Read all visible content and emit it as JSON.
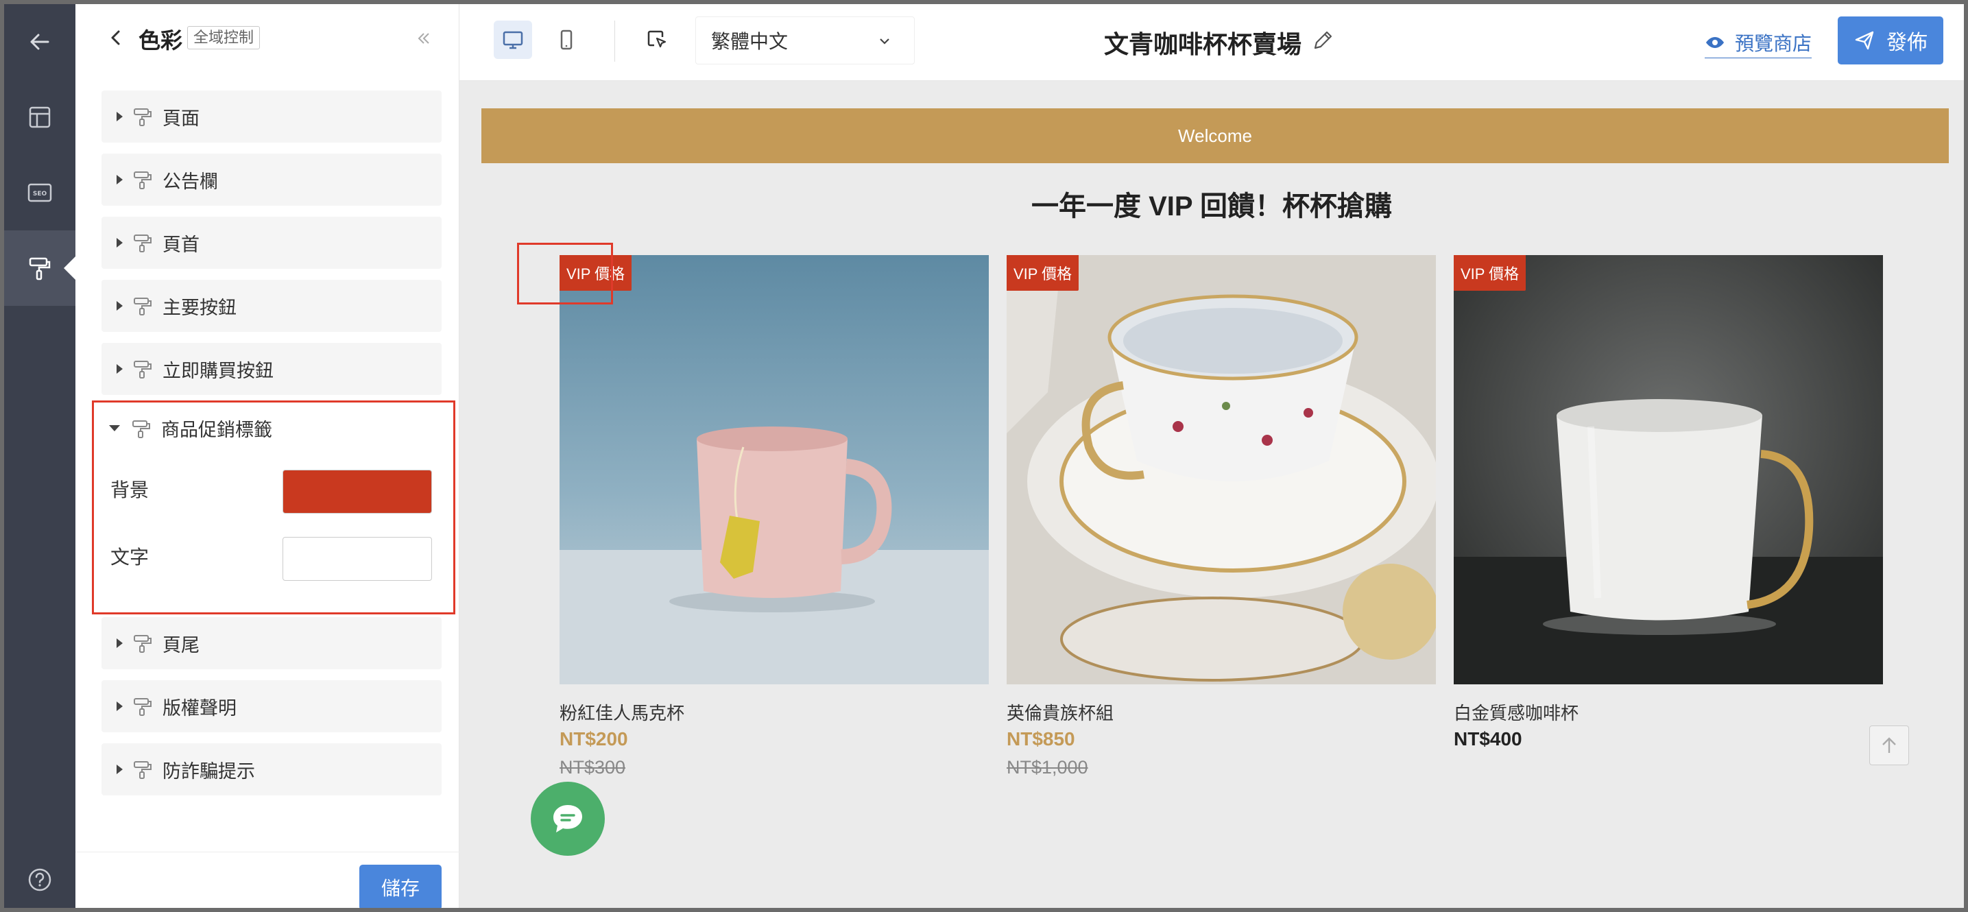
{
  "panel": {
    "title": "色彩",
    "scope_tag": "全域控制",
    "sections_top": [
      {
        "label": "頁面"
      },
      {
        "label": "公告欄"
      },
      {
        "label": "頁首"
      },
      {
        "label": "主要按鈕"
      },
      {
        "label": "立即購買按鈕"
      }
    ],
    "promo_section": {
      "label": "商品促銷標籤",
      "background_label": "背景",
      "background_color": "#c9391f",
      "text_label": "文字",
      "text_color": "#ffffff"
    },
    "sections_bottom": [
      {
        "label": "頁尾"
      },
      {
        "label": "版權聲明"
      },
      {
        "label": "防詐騙提示"
      }
    ],
    "save_label": "儲存"
  },
  "toolbar": {
    "language": "繁體中文",
    "store_title": "文青咖啡杯杯賣場",
    "preview_label": "預覽商店",
    "publish_label": "發佈"
  },
  "preview": {
    "welcome_text": "Welcome",
    "headline": "一年一度 VIP 回饋！杯杯搶購",
    "accent_color": "#c49a57",
    "products": [
      {
        "name": "粉紅佳人馬克杯",
        "price": "NT$200",
        "original_price": "NT$300",
        "badge": "VIP 價格"
      },
      {
        "name": "英倫貴族杯組",
        "price": "NT$850",
        "original_price": "NT$1,000",
        "badge": "VIP 價格"
      },
      {
        "name": "白金質感咖啡杯",
        "price": "NT$400",
        "original_price": "",
        "badge": "VIP 價格"
      }
    ]
  },
  "icons": {
    "rail": [
      "back-arrow-icon",
      "layout-icon",
      "seo-icon",
      "paint-roller-icon",
      "help-icon"
    ]
  }
}
